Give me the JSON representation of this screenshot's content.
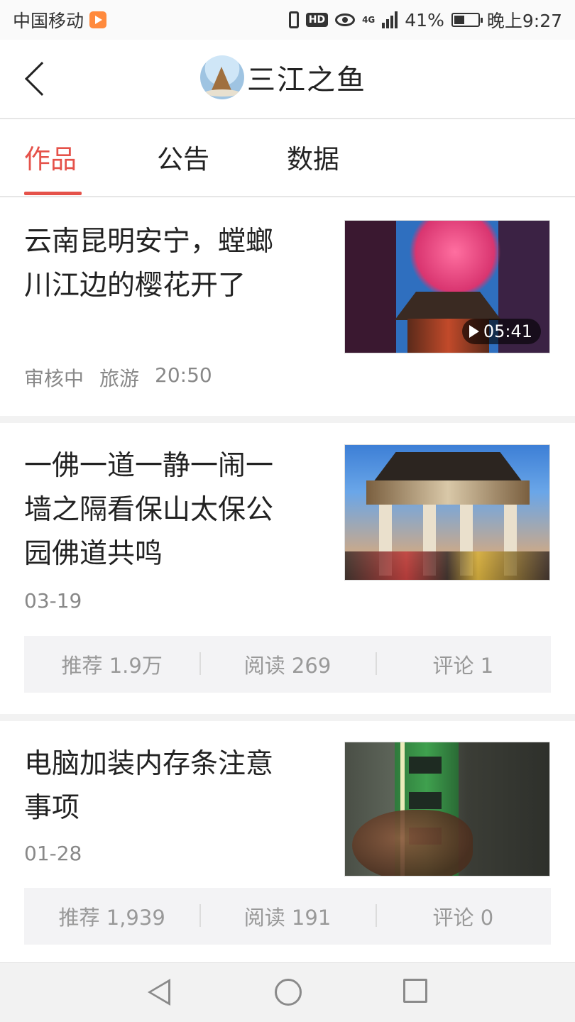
{
  "status_bar": {
    "carrier": "中国移动",
    "network": "4G",
    "battery": "41%",
    "time": "晚上9:27",
    "hd": "HD"
  },
  "header": {
    "title": "三江之鱼",
    "avatar_icon": "rockery-avatar"
  },
  "tabs": [
    {
      "label": "作品",
      "active": true
    },
    {
      "label": "公告",
      "active": false
    },
    {
      "label": "数据",
      "active": false
    }
  ],
  "articles": [
    {
      "title": "云南昆明安宁，螳螂川江边的樱花开了",
      "status": "审核中",
      "category": "旅游",
      "time": "20:50",
      "duration": "05:41"
    },
    {
      "title": "一佛一道一静一闹一墙之隔看保山太保公园佛道共鸣",
      "date": "03-19",
      "stats": {
        "recommend": "推荐 1.9万",
        "reads": "阅读 269",
        "comments": "评论 1"
      }
    },
    {
      "title": "电脑加装内存条注意事项",
      "date": "01-28",
      "stats": {
        "recommend": "推荐 1,939",
        "reads": "阅读 191",
        "comments": "评论 0"
      }
    }
  ],
  "colors": {
    "accent": "#e5524a",
    "stats_bg": "#f3f3f5",
    "meta_text": "#888888"
  }
}
